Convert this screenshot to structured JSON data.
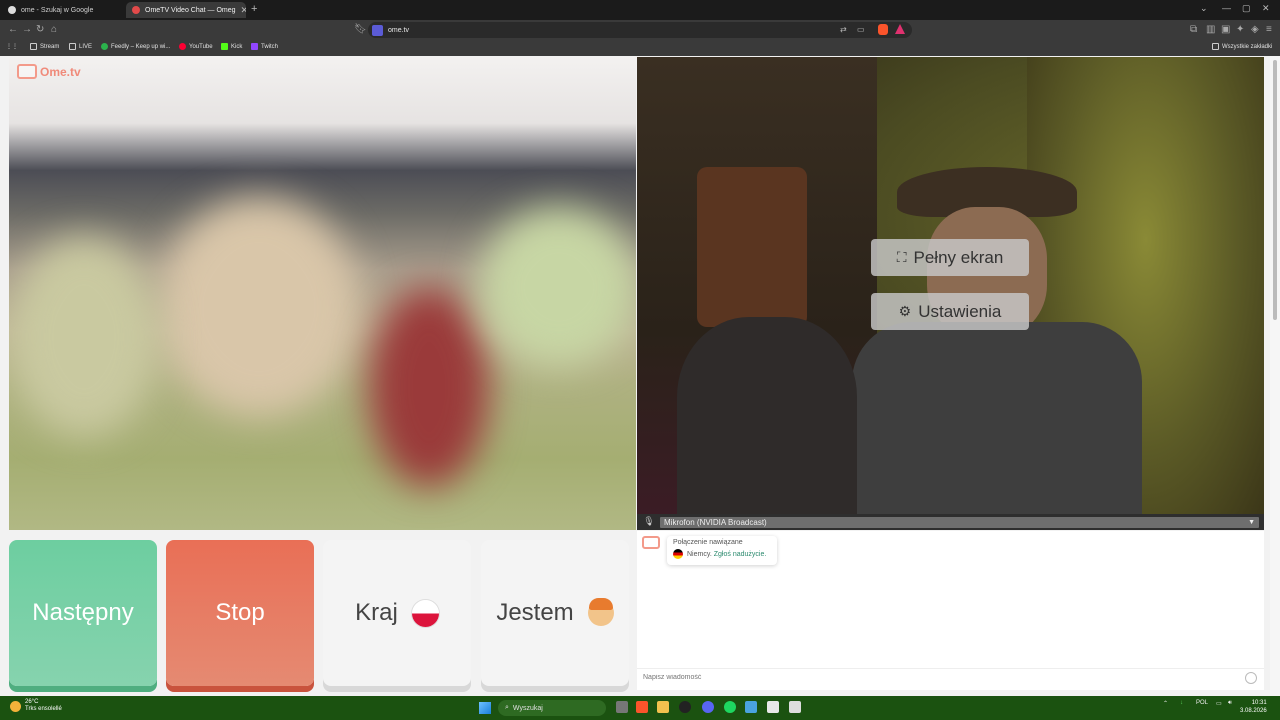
{
  "browser": {
    "tabs": [
      {
        "title": "ome - Szukaj w Google",
        "active": false
      },
      {
        "title": "OmeTV Video Chat — Omeg",
        "active": true
      }
    ],
    "url": "ome.tv",
    "bookmarks": [
      {
        "label": "Stream",
        "icon": "folder-icon"
      },
      {
        "label": "LIVE",
        "icon": "folder-icon"
      },
      {
        "label": "Feedly – Keep up wi...",
        "icon": "feedly-icon"
      },
      {
        "label": "YouTube",
        "icon": "youtube-icon"
      },
      {
        "label": "Kick",
        "icon": "kick-icon"
      },
      {
        "label": "Twitch",
        "icon": "twitch-icon"
      }
    ],
    "all_bookmarks_label": "Wszystkie zakładki"
  },
  "page": {
    "logo_text": "Ome.tv",
    "overlay": {
      "fullscreen_label": "Pełny ekran",
      "settings_label": "Ustawienia"
    },
    "microphone": {
      "selected": "Mikrofon (NVIDIA Broadcast)"
    },
    "buttons": {
      "next": "Następny",
      "stop": "Stop",
      "country": "Kraj",
      "gender": "Jestem"
    },
    "chat": {
      "status_title": "Połączenie nawiązane",
      "country_text": "Niemcy.",
      "report_link": "Zgłoś nadużycie.",
      "input_placeholder": "Napisz wiadomość"
    },
    "colors": {
      "next": "#6dcea0",
      "stop": "#e96f56",
      "brand": "#f08a7a"
    }
  },
  "taskbar": {
    "weather_temp": "26°C",
    "weather_desc": "Trks ensolellé",
    "search_placeholder": "Wyszukaj",
    "language": "POL",
    "time": "10:31",
    "date": "3.08.2026"
  }
}
